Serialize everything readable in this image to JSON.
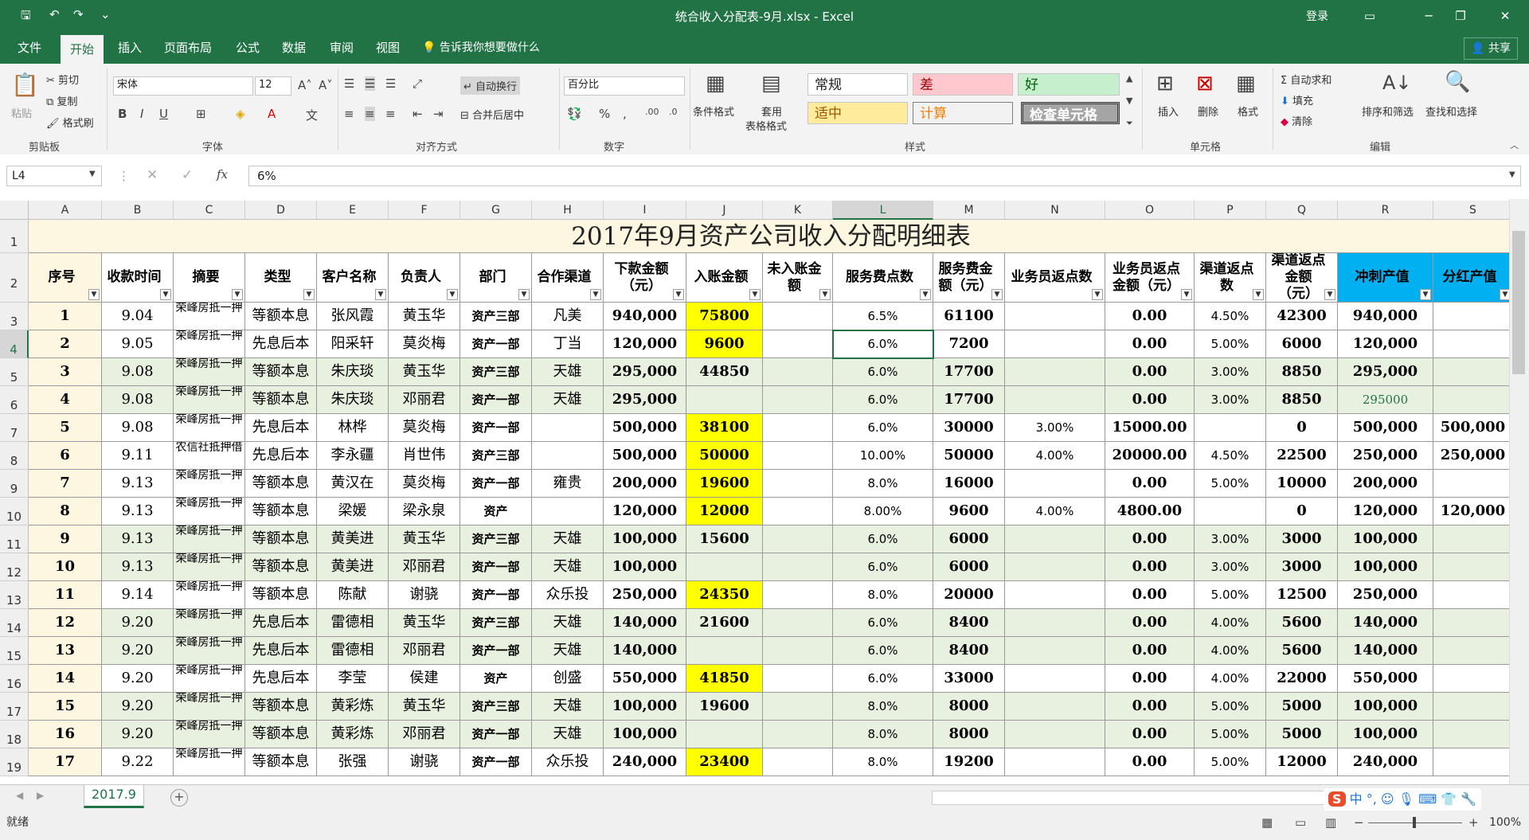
{
  "window": {
    "title": "统合收入分配表-9月.xlsx  -  Excel",
    "login": "登录",
    "qa_icons": [
      "save-icon",
      "undo-icon",
      "redo-icon",
      "customize-icon"
    ]
  },
  "menu": {
    "tabs": [
      "文件",
      "开始",
      "插入",
      "页面布局",
      "公式",
      "数据",
      "审阅",
      "视图"
    ],
    "active": "开始",
    "tell_me": "告诉我你想要做什么",
    "share": "共享"
  },
  "ribbon": {
    "clipboard": {
      "paste": "粘贴",
      "cut": "剪切",
      "copy": "复制",
      "format_painter": "格式刷",
      "label": "剪贴板"
    },
    "font": {
      "name": "宋体",
      "size": "12",
      "label": "字体",
      "bold": "B",
      "italic": "I",
      "underline": "U"
    },
    "alignment": {
      "wrap": "自动换行",
      "merge": "合并后居中",
      "label": "对齐方式"
    },
    "number": {
      "format": "百分比",
      "percent": "%",
      "comma": ",",
      "label": "数字"
    },
    "styles": {
      "cond_format": "条件格式",
      "table_format_1": "套用",
      "table_format_2": "表格格式",
      "normal": "常规",
      "bad": "差",
      "good": "好",
      "neutral": "适中",
      "calc": "计算",
      "check": "检查单元格",
      "label": "样式"
    },
    "cells": {
      "insert": "插入",
      "delete": "删除",
      "format": "格式",
      "label": "单元格"
    },
    "editing": {
      "autosum": "自动求和",
      "fill": "填充",
      "clear": "清除",
      "sort": "排序和筛选",
      "find": "查找和选择",
      "label": "编辑"
    }
  },
  "formula_bar": {
    "name_box": "L4",
    "value": "6%",
    "fx": "fx"
  },
  "sheet": {
    "columns": [
      "A",
      "B",
      "C",
      "D",
      "E",
      "F",
      "G",
      "H",
      "I",
      "J",
      "K",
      "L",
      "M",
      "N",
      "O",
      "P",
      "Q",
      "R",
      "S"
    ],
    "selected_col": "L",
    "selected_row": "4",
    "title": "2017年9月资产公司收入分配明细表",
    "headers": [
      "序号",
      "收款时间",
      "摘要",
      "类型",
      "客户名称",
      "负责人",
      "部门",
      "合作渠道",
      "下款金额（元）",
      "入账金额",
      "未入账金额",
      "服务费点数",
      "服务费金额（元）",
      "业务员返点数",
      "业务员返点金额（元）",
      "渠道返点数",
      "渠道返点金额（元）",
      "冲刺产值",
      "分红产值"
    ],
    "rows": [
      {
        "n": "3",
        "c": [
          "1",
          "9.04",
          "荣峰房抵一押",
          "等额本息",
          "张风霞",
          "黄玉华",
          "资产三部",
          "凡美",
          "940,000",
          "75800",
          "",
          "6.5%",
          "61100",
          "",
          "0.00",
          "4.50%",
          "42300",
          "940,000",
          ""
        ]
      },
      {
        "n": "4",
        "c": [
          "2",
          "9.05",
          "荣峰房抵一押",
          "先息后本",
          "阳采轩",
          "莫炎梅",
          "资产一部",
          "丁当",
          "120,000",
          "9600",
          "",
          "6.0%",
          "7200",
          "",
          "0.00",
          "5.00%",
          "6000",
          "120,000",
          ""
        ]
      },
      {
        "n": "5",
        "c": [
          "3",
          "9.08",
          "荣峰房抵一押",
          "等额本息",
          "朱庆琰",
          "黄玉华",
          "资产三部",
          "天雄",
          "295,000",
          "44850",
          "",
          "6.0%",
          "17700",
          "",
          "0.00",
          "3.00%",
          "8850",
          "295,000",
          ""
        ]
      },
      {
        "n": "6",
        "c": [
          "4",
          "9.08",
          "荣峰房抵一押",
          "等额本息",
          "朱庆琰",
          "邓丽君",
          "资产一部",
          "天雄",
          "295,000",
          "",
          "",
          "6.0%",
          "17700",
          "",
          "0.00",
          "3.00%",
          "8850",
          "295000",
          ""
        ]
      },
      {
        "n": "7",
        "c": [
          "5",
          "9.08",
          "荣峰房抵一押",
          "先息后本",
          "林桦",
          "莫炎梅",
          "资产一部",
          "",
          "500,000",
          "38100",
          "",
          "6.0%",
          "30000",
          "3.00%",
          "15000.00",
          "",
          "0",
          "500,000",
          "500,000"
        ]
      },
      {
        "n": "8",
        "c": [
          "6",
          "9.11",
          "农信社抵押借",
          "先息后本",
          "李永疆",
          "肖世伟",
          "资产三部",
          "",
          "500,000",
          "50000",
          "",
          "10.00%",
          "50000",
          "4.00%",
          "20000.00",
          "4.50%",
          "22500",
          "250,000",
          "250,000"
        ]
      },
      {
        "n": "9",
        "c": [
          "7",
          "9.13",
          "荣峰房抵一押",
          "等额本息",
          "黄汉在",
          "莫炎梅",
          "资产一部",
          "雍贵",
          "200,000",
          "19600",
          "",
          "8.0%",
          "16000",
          "",
          "0.00",
          "5.00%",
          "10000",
          "200,000",
          ""
        ]
      },
      {
        "n": "10",
        "c": [
          "8",
          "9.13",
          "荣峰房抵一押",
          "等额本息",
          "梁媛",
          "梁永泉",
          "资产",
          "",
          "120,000",
          "12000",
          "",
          "8.00%",
          "9600",
          "4.00%",
          "4800.00",
          "",
          "0",
          "120,000",
          "120,000"
        ]
      },
      {
        "n": "11",
        "c": [
          "9",
          "9.13",
          "荣峰房抵一押",
          "等额本息",
          "黄美进",
          "黄玉华",
          "资产三部",
          "天雄",
          "100,000",
          "15600",
          "",
          "6.0%",
          "6000",
          "",
          "0.00",
          "3.00%",
          "3000",
          "100,000",
          ""
        ]
      },
      {
        "n": "12",
        "c": [
          "10",
          "9.13",
          "荣峰房抵一押",
          "等额本息",
          "黄美进",
          "邓丽君",
          "资产一部",
          "天雄",
          "100,000",
          "",
          "",
          "6.0%",
          "6000",
          "",
          "0.00",
          "3.00%",
          "3000",
          "100,000",
          ""
        ]
      },
      {
        "n": "13",
        "c": [
          "11",
          "9.14",
          "荣峰房抵一押",
          "等额本息",
          "陈献",
          "谢骁",
          "资产一部",
          "众乐投",
          "250,000",
          "24350",
          "",
          "8.0%",
          "20000",
          "",
          "0.00",
          "5.00%",
          "12500",
          "250,000",
          ""
        ]
      },
      {
        "n": "14",
        "c": [
          "12",
          "9.20",
          "荣峰房抵一押",
          "先息后本",
          "雷德相",
          "黄玉华",
          "资产三部",
          "天雄",
          "140,000",
          "21600",
          "",
          "6.0%",
          "8400",
          "",
          "0.00",
          "4.00%",
          "5600",
          "140,000",
          ""
        ]
      },
      {
        "n": "15",
        "c": [
          "13",
          "9.20",
          "荣峰房抵一押",
          "先息后本",
          "雷德相",
          "邓丽君",
          "资产一部",
          "天雄",
          "140,000",
          "",
          "",
          "6.0%",
          "8400",
          "",
          "0.00",
          "4.00%",
          "5600",
          "140,000",
          ""
        ]
      },
      {
        "n": "16",
        "c": [
          "14",
          "9.20",
          "荣峰房抵一押",
          "先息后本",
          "李莹",
          "侯建",
          "资产",
          "创盛",
          "550,000",
          "41850",
          "",
          "6.0%",
          "33000",
          "",
          "0.00",
          "4.00%",
          "22000",
          "550,000",
          ""
        ]
      },
      {
        "n": "17",
        "c": [
          "15",
          "9.20",
          "荣峰房抵一押",
          "等额本息",
          "黄彩炼",
          "黄玉华",
          "资产三部",
          "天雄",
          "100,000",
          "19600",
          "",
          "8.0%",
          "8000",
          "",
          "0.00",
          "5.00%",
          "5000",
          "100,000",
          ""
        ]
      },
      {
        "n": "18",
        "c": [
          "16",
          "9.20",
          "荣峰房抵一押",
          "等额本息",
          "黄彩炼",
          "邓丽君",
          "资产一部",
          "天雄",
          "100,000",
          "",
          "",
          "8.0%",
          "8000",
          "",
          "0.00",
          "5.00%",
          "5000",
          "100,000",
          ""
        ]
      },
      {
        "n": "19",
        "c": [
          "17",
          "9.22",
          "荣峰房抵一押",
          "等额本息",
          "张强",
          "谢骁",
          "资产一部",
          "众乐投",
          "240,000",
          "23400",
          "",
          "8.0%",
          "19200",
          "",
          "0.00",
          "5.00%",
          "12000",
          "240,000",
          ""
        ]
      }
    ],
    "row_bg": [
      "#ffffff",
      "#ffffff",
      "#e8f1df",
      "#e8f1df",
      "#ffffff",
      "#ffffff",
      "#ffffff",
      "#ffffff",
      "#e8f1df",
      "#e8f1df",
      "#ffffff",
      "#e8f1df",
      "#e8f1df",
      "#ffffff",
      "#e8f1df",
      "#e8f1df",
      "#ffffff"
    ],
    "yellow_rows": [
      "3",
      "4",
      "7",
      "8",
      "9",
      "10",
      "13",
      "16",
      "19"
    ],
    "colors": {
      "accent": "#217346",
      "yellow": "#ffff00",
      "cyan_header": "#00b0f0",
      "title_bg": "#fdf6e0"
    }
  },
  "sheet_tab": "2017.9",
  "status": {
    "ready": "就绪",
    "zoom": "100%"
  },
  "ime": {
    "s": "S",
    "cn": "中"
  }
}
